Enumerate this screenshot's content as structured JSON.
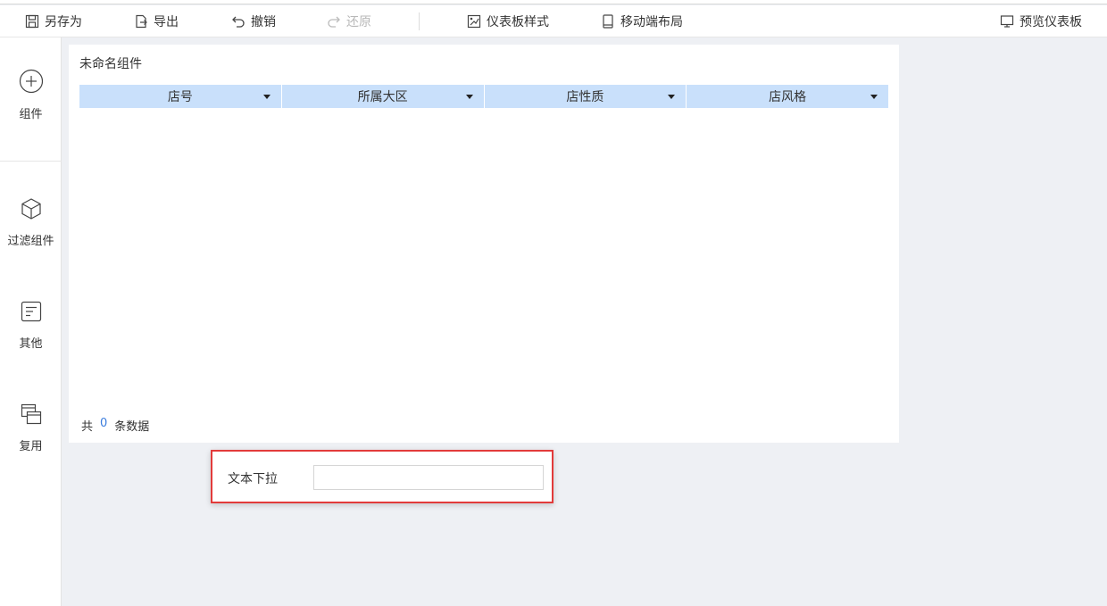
{
  "toolbar": {
    "save_as": "另存为",
    "export": "导出",
    "undo": "撤销",
    "redo": "还原",
    "dashboard_style": "仪表板样式",
    "mobile_layout": "移动端布局",
    "preview": "预览仪表板"
  },
  "sidebar": {
    "items": [
      {
        "label": "组件",
        "icon": "plus-circle-icon"
      },
      {
        "label": "过滤组件",
        "icon": "cube-icon"
      },
      {
        "label": "其他",
        "icon": "text-box-icon"
      },
      {
        "label": "复用",
        "icon": "copy-windows-icon"
      }
    ]
  },
  "widget": {
    "title": "未命名组件",
    "columns": [
      "店号",
      "所属大区",
      "店性质",
      "店风格"
    ],
    "count_prefix": "共",
    "count_value": "0",
    "count_suffix": "条数据"
  },
  "filter": {
    "label": "文本下拉",
    "value": "",
    "placeholder": ""
  },
  "colors": {
    "header_bg": "#c9e0fb",
    "highlight_border": "#e23b3b",
    "count_accent": "#3b7ddd",
    "canvas_bg": "#eef0f4"
  }
}
